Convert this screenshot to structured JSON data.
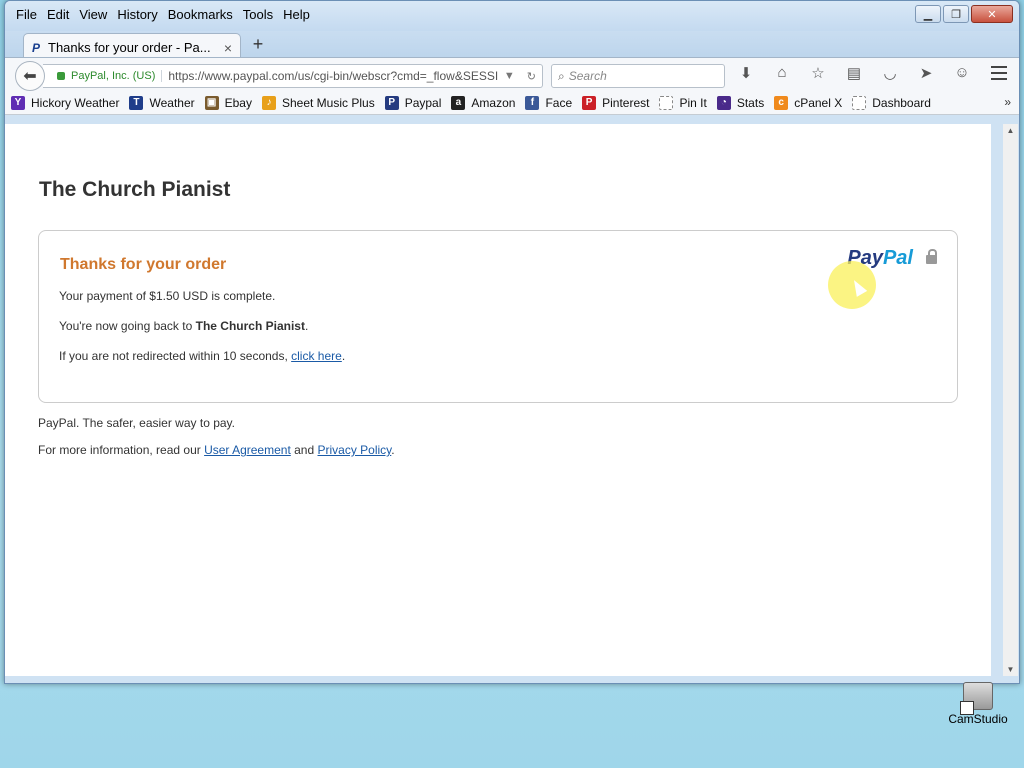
{
  "menubar": [
    "File",
    "Edit",
    "View",
    "History",
    "Bookmarks",
    "Tools",
    "Help"
  ],
  "tab": {
    "title": "Thanks for your order - Pa...",
    "favicon": "paypal-icon",
    "close": "×"
  },
  "newtab": "+",
  "navbar": {
    "identity": "PayPal, Inc. (US)",
    "url": "https://www.paypal.com/us/cgi-bin/webscr?cmd=_flow&SESSIO",
    "search_placeholder": "Search"
  },
  "bookmarks": [
    {
      "label": "Hickory Weather",
      "icon": "yahoo-icon",
      "color": "#5f2db3",
      "glyph": "Y"
    },
    {
      "label": "Weather",
      "icon": "twc-icon",
      "color": "#1f3d8a",
      "glyph": "T"
    },
    {
      "label": "Ebay",
      "icon": "shopping-bag-icon",
      "color": "#7a5b2e",
      "glyph": "▣"
    },
    {
      "label": "Sheet Music Plus",
      "icon": "music-note-icon",
      "color": "#e8a01a",
      "glyph": "♪"
    },
    {
      "label": "Paypal",
      "icon": "paypal-icon",
      "color": "#253b80",
      "glyph": "P"
    },
    {
      "label": "Amazon",
      "icon": "amazon-icon",
      "color": "#222222",
      "glyph": "a"
    },
    {
      "label": "Face",
      "icon": "facebook-icon",
      "color": "#3b5998",
      "glyph": "f"
    },
    {
      "label": "Pinterest",
      "icon": "pinterest-icon",
      "color": "#cb2027",
      "glyph": "P"
    },
    {
      "label": "Pin It",
      "icon": "blank-page-icon",
      "color": "#ffffff",
      "glyph": ""
    },
    {
      "label": "Stats",
      "icon": "pie-chart-icon",
      "color": "#4a2a8a",
      "glyph": "◔"
    },
    {
      "label": "cPanel X",
      "icon": "cpanel-icon",
      "color": "#f08a1c",
      "glyph": "c"
    },
    {
      "label": "Dashboard",
      "icon": "blank-page-icon",
      "color": "#ffffff",
      "glyph": ""
    }
  ],
  "page": {
    "merchant": "The Church Pianist",
    "heading": "Thanks for your order",
    "payment_text": "Your payment of $1.50 USD is complete.",
    "going_back_prefix": "You're now going back to ",
    "going_back_name": "The Church Pianist",
    "going_back_suffix": ".",
    "redirect_prefix": "If you are not redirected within 10 seconds, ",
    "redirect_link": "click here",
    "redirect_suffix": ".",
    "logo_pay": "Pay",
    "logo_pal": "Pal",
    "footer_tagline": "PayPal. The safer, easier way to pay.",
    "footer_info_prefix": "For more information, read our ",
    "user_agreement": "User Agreement",
    "footer_and": " and ",
    "privacy_policy": "Privacy Policy",
    "footer_suffix": "."
  },
  "desktop": {
    "icon_label": "CamStudio"
  },
  "colors": {
    "heading": "#d0782e",
    "link": "#1a5aa6",
    "pay": "#253b80",
    "pal": "#179bd7"
  }
}
